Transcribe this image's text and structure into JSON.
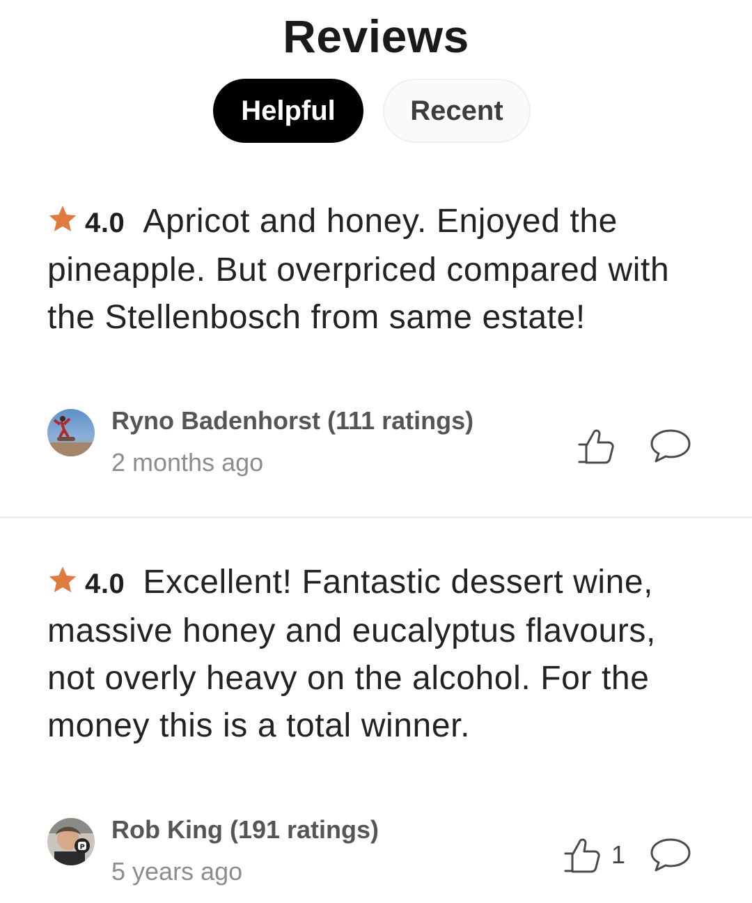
{
  "header": {
    "title": "Reviews"
  },
  "tabs": [
    {
      "label": "Helpful",
      "active": true
    },
    {
      "label": "Recent",
      "active": false
    }
  ],
  "colors": {
    "star": "#e07a3f",
    "active_tab_bg": "#000000",
    "inactive_tab_bg": "#fafaf8"
  },
  "reviews": [
    {
      "rating": "4.0",
      "text": "Apricot and honey. Enjoyed the pineapple.  But overpriced compared with the Stellenbosch from same estate!",
      "author": "Ryno Badenhorst (111 ratings)",
      "time": "2 months ago",
      "likes": "",
      "icons": {
        "star": "star-icon",
        "like": "thumbs-up-icon",
        "comment": "comment-bubble-icon"
      }
    },
    {
      "rating": "4.0",
      "text": "Excellent! Fantastic dessert wine, massive honey and eucalyptus flavours, not overly heavy on the alcohol. For the money this is a total winner.",
      "author": "Rob King (191 ratings)",
      "time": "5 years ago",
      "likes": "1",
      "icons": {
        "star": "star-icon",
        "like": "thumbs-up-icon",
        "comment": "comment-bubble-icon"
      }
    }
  ]
}
